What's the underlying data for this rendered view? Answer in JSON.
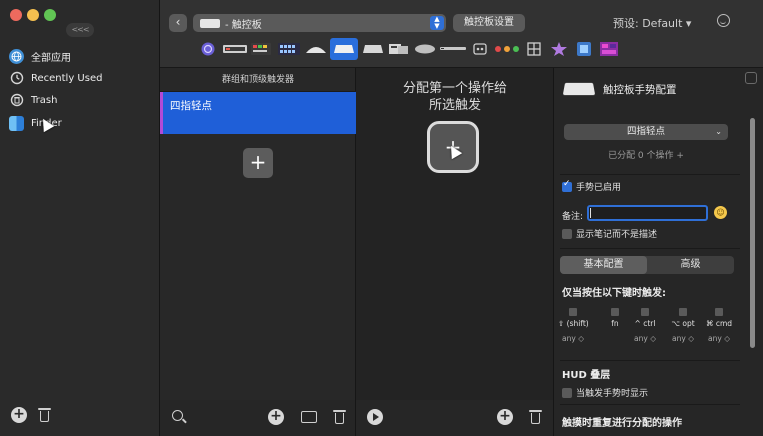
{
  "sidebar": {
    "collapse_label": "<<<",
    "items": [
      {
        "label": "全部应用",
        "icon": "globe-icon",
        "color": "#3f8fd6"
      },
      {
        "label": "Recently Used",
        "icon": "clock-icon",
        "color": "#d0d0d0"
      },
      {
        "label": "Trash",
        "icon": "trash-icon",
        "color": "#d0d0d0"
      },
      {
        "label": "Finder",
        "icon": "finder-icon",
        "color": "#3f8fd6"
      }
    ]
  },
  "toolbar": {
    "back_label": "‹",
    "device_label": "- 触控板",
    "settings_button": "触控板设置",
    "preset_label": "预设: Default ▾"
  },
  "device_strip": [
    {
      "name": "touchbar-icon"
    },
    {
      "name": "keyboard-icon"
    },
    {
      "name": "colorful-keyboard-icon"
    },
    {
      "name": "keyboard-keys-icon"
    },
    {
      "name": "magic-mouse-icon"
    },
    {
      "name": "trackpad-icon",
      "selected": true
    },
    {
      "name": "trackpad-alt-icon"
    },
    {
      "name": "remote-icon"
    },
    {
      "name": "mouse-icon"
    },
    {
      "name": "siri-remote-icon"
    },
    {
      "name": "music-remote-icon"
    },
    {
      "name": "colored-dots-icon"
    },
    {
      "name": "grid-icon"
    },
    {
      "name": "star-icon"
    },
    {
      "name": "stream-deck-icon"
    },
    {
      "name": "color-tiles-icon"
    }
  ],
  "groups": {
    "header": "群组和顶级触发器",
    "items": [
      {
        "label": "四指轻点"
      }
    ],
    "add_label": "+"
  },
  "actions": {
    "prompt_line1": "分配第一个操作给",
    "prompt_line2": "所选触发",
    "add_label": "+"
  },
  "config": {
    "title": "触控板手势配置",
    "gesture_value": "四指轻点",
    "assigned_count": "已分配 0 个操作 +",
    "gesture_enabled_label": "手势已启用",
    "gesture_enabled": true,
    "note_label": "备注:",
    "note_value": "",
    "show_note_label": "显示笔记而不是描述",
    "tabs": [
      "基本配置",
      "高级"
    ],
    "active_tab": "基本配置",
    "modifier_title": "仅当按住以下键时触发:",
    "modifiers": [
      {
        "label": "⇧ (shift)",
        "mode": "any ◇"
      },
      {
        "label": "fn",
        "mode": ""
      },
      {
        "label": "^ ctrl",
        "mode": "any ◇"
      },
      {
        "label": "⌥ opt",
        "mode": "any ◇"
      },
      {
        "label": "⌘ cmd",
        "mode": "any ◇"
      }
    ],
    "hud_title": "HUD 叠层",
    "hud_option": "当触发手势时显示",
    "repeat_title": "触摸时重复进行分配的操作"
  },
  "colors": {
    "accent": "#2f6fd6",
    "selection": "#1f5fd8",
    "group_accent": "#b24ad6"
  }
}
